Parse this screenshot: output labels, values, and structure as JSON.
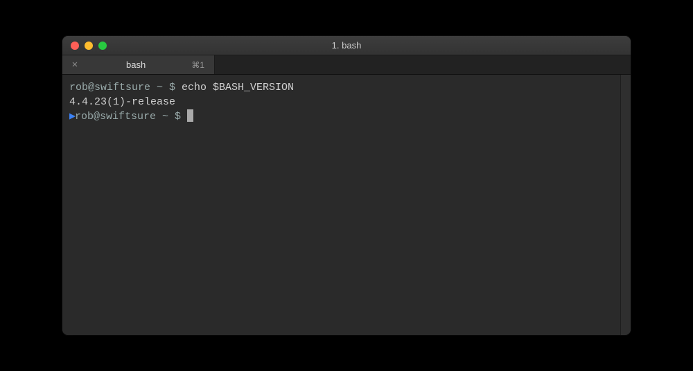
{
  "window": {
    "title": "1. bash"
  },
  "tab": {
    "label": "bash",
    "shortcut": "⌘1",
    "close_glyph": "✕"
  },
  "terminal": {
    "line1_prompt": "rob@swiftsure ~ $ ",
    "line1_cmd": "echo $BASH_VERSION",
    "line2_output": "4.4.23(1)-release",
    "line3_marker": "▶",
    "line3_prompt": "rob@swiftsure ~ $ "
  }
}
